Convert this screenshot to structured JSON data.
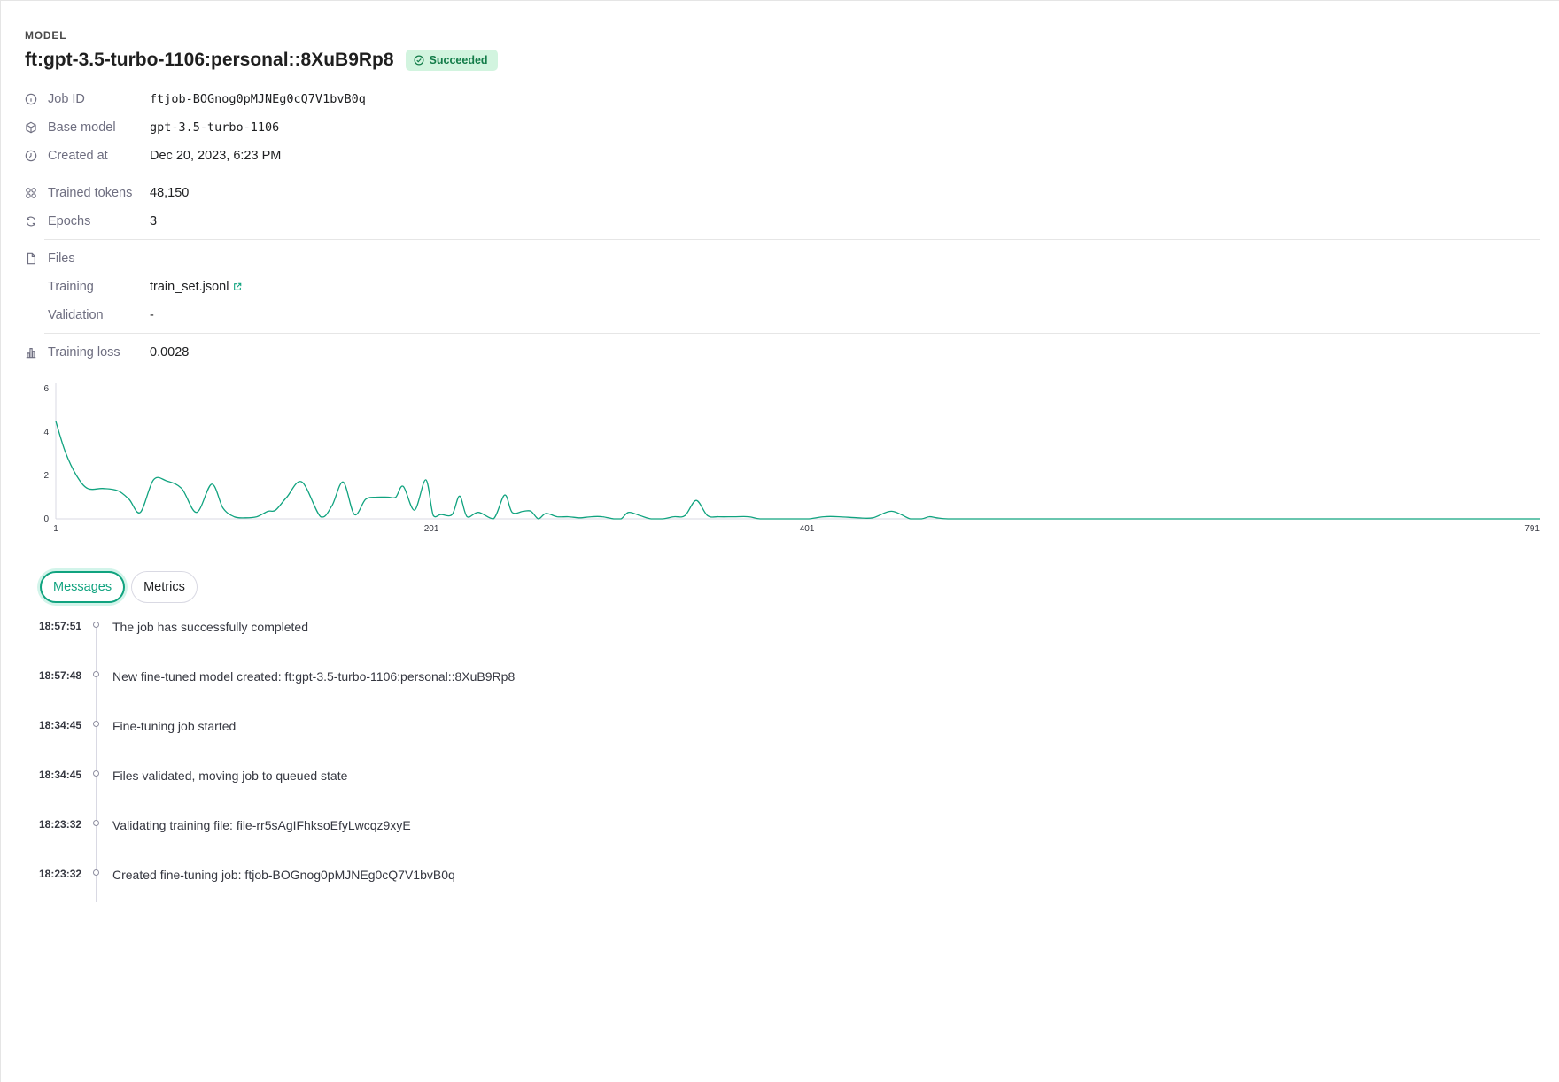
{
  "header": {
    "eyebrow": "MODEL",
    "title": "ft:gpt-3.5-turbo-1106:personal::8XuB9Rp8",
    "status": "Succeeded",
    "status_color": "#137c49"
  },
  "details": {
    "job_id": {
      "label": "Job ID",
      "value": "ftjob-BOGnog0pMJNEg0cQ7V1bvB0q",
      "icon": "info-icon"
    },
    "base_model": {
      "label": "Base model",
      "value": "gpt-3.5-turbo-1106",
      "icon": "cube-icon"
    },
    "created_at": {
      "label": "Created at",
      "value": "Dec 20, 2023, 6:23 PM",
      "icon": "clock-icon"
    },
    "trained_tokens": {
      "label": "Trained tokens",
      "value": "48,150",
      "icon": "grid-icon"
    },
    "epochs": {
      "label": "Epochs",
      "value": "3",
      "icon": "refresh-icon"
    },
    "files": {
      "label": "Files",
      "icon": "file-icon",
      "training_label": "Training",
      "training_value": "train_set.jsonl",
      "validation_label": "Validation",
      "validation_value": "-"
    },
    "training_loss": {
      "label": "Training loss",
      "value": "0.0028",
      "icon": "bar-chart-icon"
    }
  },
  "chart_data": {
    "type": "line",
    "title": "",
    "xlabel": "",
    "ylabel": "",
    "x_ticks": [
      "1",
      "201",
      "401",
      "791"
    ],
    "y_ticks": [
      "0",
      "2",
      "4",
      "6"
    ],
    "xlim": [
      1,
      791
    ],
    "ylim": [
      0,
      6
    ],
    "grid": false,
    "color": "#10a37f",
    "series": [
      {
        "x": [
          1,
          6,
          12,
          18,
          26,
          34,
          40,
          46,
          53,
          60,
          68,
          76,
          84,
          90,
          96,
          102,
          108,
          114,
          118,
          124,
          132,
          142,
          148,
          154,
          160,
          166,
          172,
          178,
          182,
          186,
          192,
          198,
          202,
          206,
          212,
          216,
          220,
          226,
          234,
          240,
          244,
          250,
          254,
          258,
          262,
          268,
          274,
          280,
          286,
          292,
          298,
          302,
          306,
          312,
          318,
          324,
          330,
          336,
          342,
          348,
          354,
          362,
          370,
          376,
          386,
          396,
          402,
          410,
          418,
          428,
          436,
          446,
          456,
          462,
          466,
          470,
          476,
          486,
          496,
          508,
          520,
          530,
          544,
          558,
          572,
          586,
          598,
          610,
          618,
          622,
          626,
          632,
          642,
          652,
          664,
          674,
          682,
          690,
          698,
          708,
          718,
          730,
          744,
          758,
          766,
          772,
          778,
          782,
          786,
          791
        ],
        "values": [
          4.5,
          3.1,
          2.0,
          1.4,
          1.4,
          1.3,
          0.9,
          0.3,
          1.8,
          1.75,
          1.4,
          0.3,
          1.6,
          0.5,
          0.1,
          0.05,
          0.1,
          0.35,
          0.4,
          1.0,
          1.7,
          0.1,
          0.6,
          1.7,
          0.2,
          0.9,
          1.0,
          1.0,
          1.0,
          1.5,
          0.4,
          1.8,
          0.15,
          0.2,
          0.2,
          1.05,
          0.1,
          0.3,
          0.0,
          1.1,
          0.3,
          0.35,
          0.35,
          0.0,
          0.25,
          0.1,
          0.1,
          0.05,
          0.1,
          0.1,
          0.0,
          0.0,
          0.3,
          0.15,
          0.0,
          0.0,
          0.1,
          0.15,
          0.85,
          0.15,
          0.1,
          0.1,
          0.1,
          0.0,
          0.0,
          0.0,
          0.0,
          0.1,
          0.1,
          0.05,
          0.05,
          0.35,
          0.0,
          0.0,
          0.1,
          0.05,
          0.0,
          0.0,
          0.0,
          0.0,
          0.0,
          0.0,
          0.0,
          0.0,
          0.0,
          0.0,
          0.0,
          0.0,
          0.0,
          0.0,
          0.0,
          0.0,
          0.0,
          0.0,
          0.0,
          0.0,
          0.0,
          0.0,
          0.0,
          0.0,
          0.0,
          0.0,
          0.0,
          0.0,
          0.0,
          0.0,
          0.0,
          0.0,
          0.0,
          0.0
        ]
      }
    ]
  },
  "tabs": [
    {
      "label": "Messages",
      "active": true
    },
    {
      "label": "Metrics",
      "active": false
    }
  ],
  "events": [
    {
      "time": "18:57:51",
      "message": "The job has successfully completed"
    },
    {
      "time": "18:57:48",
      "message": "New fine-tuned model created: ft:gpt-3.5-turbo-1106:personal::8XuB9Rp8"
    },
    {
      "time": "18:34:45",
      "message": "Fine-tuning job started"
    },
    {
      "time": "18:34:45",
      "message": "Files validated, moving job to queued state"
    },
    {
      "time": "18:23:32",
      "message": "Validating training file: file-rr5sAgIFhksoEfyLwcqz9xyE"
    },
    {
      "time": "18:23:32",
      "message": "Created fine-tuning job: ftjob-BOGnog0pMJNEg0cQ7V1bvB0q"
    }
  ]
}
